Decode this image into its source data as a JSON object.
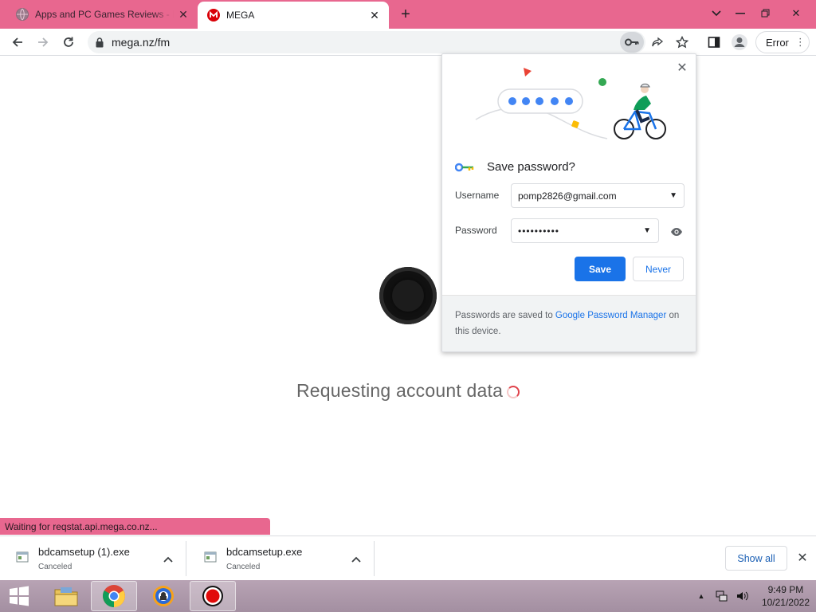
{
  "tabs": [
    {
      "title": "Apps and PC Games Reviews - Fr",
      "active": false
    },
    {
      "title": "MEGA",
      "active": true
    }
  ],
  "address_bar": {
    "url": "mega.nz/fm"
  },
  "profile_chip": {
    "label": "Error"
  },
  "page": {
    "loading_text": "Requesting account data"
  },
  "status_text": "Waiting for reqstat.api.mega.co.nz...",
  "password_popup": {
    "title": "Save password?",
    "username_label": "Username",
    "username_value": "pomp2826@gmail.com",
    "password_label": "Password",
    "password_value": "••••••••••",
    "save_label": "Save",
    "never_label": "Never",
    "footer_prefix": "Passwords are saved to ",
    "footer_link": "Google Password Manager",
    "footer_suffix": " on this device."
  },
  "downloads": [
    {
      "filename": "bdcamsetup (1).exe",
      "status": "Canceled"
    },
    {
      "filename": "bdcamsetup.exe",
      "status": "Canceled"
    }
  ],
  "show_all_label": "Show all",
  "clock": {
    "time": "9:49 PM",
    "date": "10/21/2022"
  },
  "colors": {
    "tabstrip": "#e8678f",
    "accent_blue": "#1a73e8",
    "mega_red": "#d90007"
  }
}
